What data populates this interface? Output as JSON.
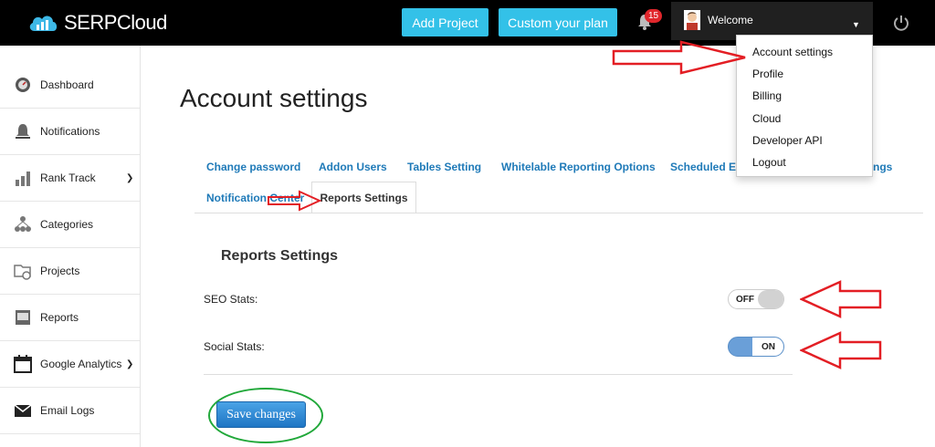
{
  "header": {
    "logo_text": "SERPCloud",
    "add_project": "Add Project",
    "custom_plan": "Custom your plan",
    "notification_count": "15",
    "welcome": "Welcome"
  },
  "sidebar": {
    "items": [
      {
        "label": "Dashboard"
      },
      {
        "label": "Notifications"
      },
      {
        "label": "Rank Track"
      },
      {
        "label": "Categories"
      },
      {
        "label": "Projects"
      },
      {
        "label": "Reports"
      },
      {
        "label": "Google Analytics"
      },
      {
        "label": "Email Logs"
      }
    ]
  },
  "main": {
    "title": "Account settings",
    "tabs": [
      {
        "label": "Change password"
      },
      {
        "label": "Addon Users"
      },
      {
        "label": "Tables Setting"
      },
      {
        "label": "Whitelable Reporting Options"
      },
      {
        "label": "Scheduled Em"
      },
      {
        "label": "ngs"
      },
      {
        "label": "Notification Center"
      },
      {
        "label": "Reports Settings"
      }
    ],
    "section_title": "Reports Settings",
    "fields": [
      {
        "label": "SEO Stats:",
        "state": "OFF"
      },
      {
        "label": "Social Stats:",
        "state": "ON"
      }
    ],
    "save_label": "Save changes"
  },
  "dropdown": {
    "items": [
      "Account settings",
      "Profile",
      "Billing",
      "Cloud",
      "Developer API",
      "Logout"
    ]
  },
  "colors": {
    "accent": "#33c1e8",
    "link": "#1f7ab8",
    "annotation_red": "#e31e24",
    "annotation_green": "#21a83a"
  }
}
